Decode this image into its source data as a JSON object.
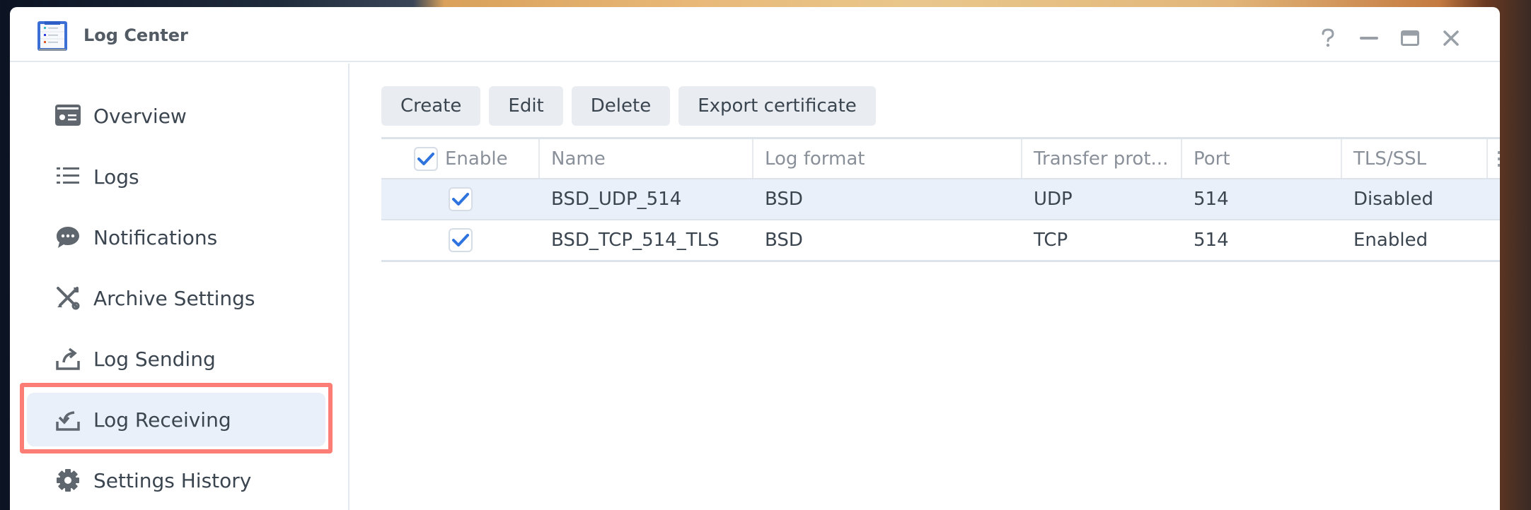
{
  "window": {
    "title": "Log Center",
    "controls": {
      "help": "help-icon",
      "minimize": "minimize-icon",
      "maximize": "maximize-icon",
      "close": "close-icon"
    }
  },
  "sidebar": {
    "items": [
      {
        "label": "Overview",
        "icon": "overview-card-icon",
        "active": false
      },
      {
        "label": "Logs",
        "icon": "list-icon",
        "active": false
      },
      {
        "label": "Notifications",
        "icon": "chat-bubble-icon",
        "active": false
      },
      {
        "label": "Archive Settings",
        "icon": "tools-icon",
        "active": false
      },
      {
        "label": "Log Sending",
        "icon": "send-out-icon",
        "active": false
      },
      {
        "label": "Log Receiving",
        "icon": "receive-in-icon",
        "active": true
      },
      {
        "label": "Settings History",
        "icon": "gear-icon",
        "active": false
      }
    ]
  },
  "toolbar": {
    "create_label": "Create",
    "edit_label": "Edit",
    "delete_label": "Delete",
    "export_label": "Export certificate"
  },
  "table": {
    "select_all_checked": true,
    "columns": {
      "enable": "Enable",
      "name": "Name",
      "log_format": "Log format",
      "transfer_protocol": "Transfer prot...",
      "port": "Port",
      "tls_ssl": "TLS/SSL"
    },
    "rows": [
      {
        "enabled": true,
        "name": "BSD_UDP_514",
        "log_format": "BSD",
        "transfer_protocol": "UDP",
        "port": "514",
        "tls_ssl": "Disabled",
        "selected": true
      },
      {
        "enabled": true,
        "name": "BSD_TCP_514_TLS",
        "log_format": "BSD",
        "transfer_protocol": "TCP",
        "port": "514",
        "tls_ssl": "Enabled",
        "selected": false
      }
    ]
  },
  "colors": {
    "accent": "#2f74de",
    "highlight_border": "#fb7d75",
    "selected_bg": "#e9f0fa"
  }
}
